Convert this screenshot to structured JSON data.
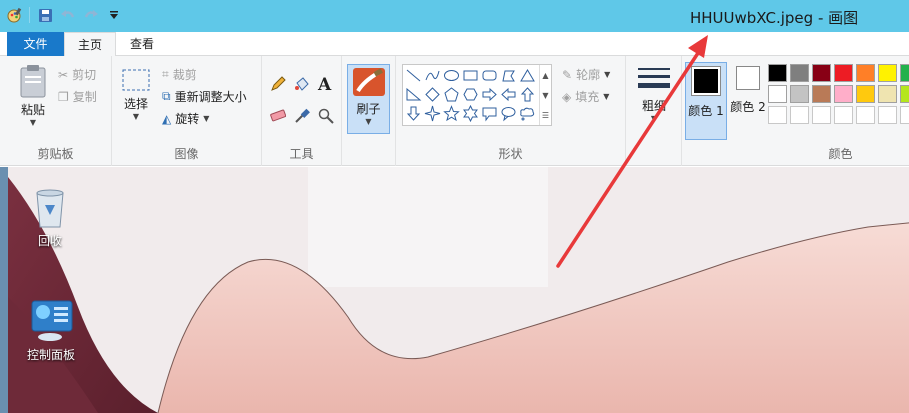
{
  "window": {
    "title": "HHUUwbXC.jpeg - 画图"
  },
  "tabs": {
    "file": "文件",
    "home": "主页",
    "view": "查看"
  },
  "clipboard": {
    "paste": "粘贴",
    "cut": "剪切",
    "copy": "复制",
    "label": "剪贴板"
  },
  "image": {
    "select": "选择",
    "crop": "裁剪",
    "resize": "重新调整大小",
    "rotate": "旋转",
    "label": "图像"
  },
  "tools": {
    "label": "工具",
    "text_glyph": "A"
  },
  "brushes": {
    "label": "刷子"
  },
  "shapes": {
    "outline": "轮廓",
    "fill": "填充",
    "label": "形状"
  },
  "size": {
    "label": "粗细"
  },
  "colors": {
    "color1": "颜色 1",
    "color2": "颜色 2",
    "label": "颜色",
    "color1_value": "#000000",
    "color2_value": "#ffffff",
    "swatches": [
      "#000000",
      "#7f7f7f",
      "#880015",
      "#ed1c24",
      "#ff7f27",
      "#fff200",
      "#22b14c",
      "#ffffff",
      "#c3c3c3",
      "#b97a57",
      "#ffaec9",
      "#ffc90e",
      "#efe4b0",
      "#b5e61d",
      "#ffffff",
      "#ffffff",
      "#ffffff",
      "#ffffff",
      "#ffffff",
      "#ffffff",
      "#ffffff"
    ]
  },
  "desktop": {
    "recycle_bin": "回收",
    "control_panel": "控制面板"
  },
  "annotation": {
    "arrow_color": "#e8393a"
  }
}
